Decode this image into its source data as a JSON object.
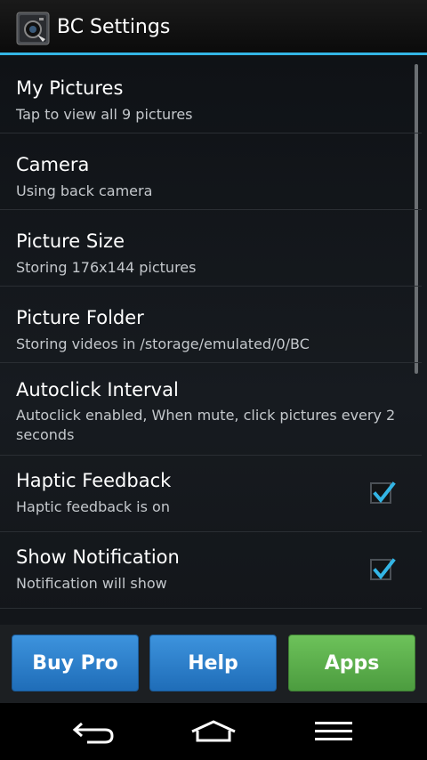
{
  "app": {
    "title": "BC Settings",
    "icon": "camera-app-icon"
  },
  "preferences": [
    {
      "title": "My Pictures",
      "summary": "Tap to view all 9 pictures"
    },
    {
      "title": "Camera",
      "summary": "Using back camera"
    },
    {
      "title": "Picture Size",
      "summary": "Storing 176x144 pictures"
    },
    {
      "title": "Picture Folder",
      "summary": "Storing videos in /storage/emulated/0/BC"
    },
    {
      "title": "Autoclick Interval",
      "summary": "Autoclick enabled, When mute, click pictures every 2 seconds"
    },
    {
      "title": "Haptic Feedback",
      "summary": "Haptic feedback is on",
      "checked": true
    },
    {
      "title": "Show Notification",
      "summary": "Notification will show",
      "checked": true
    }
  ],
  "buttons": {
    "buy_pro": "Buy Pro",
    "help": "Help",
    "apps": "Apps"
  },
  "colors": {
    "accent": "#33b5e5",
    "button_blue": "#2a7fcc",
    "button_green": "#5cb04c"
  },
  "nav": {
    "back": "back-icon",
    "home": "home-icon",
    "menu": "menu-icon"
  }
}
